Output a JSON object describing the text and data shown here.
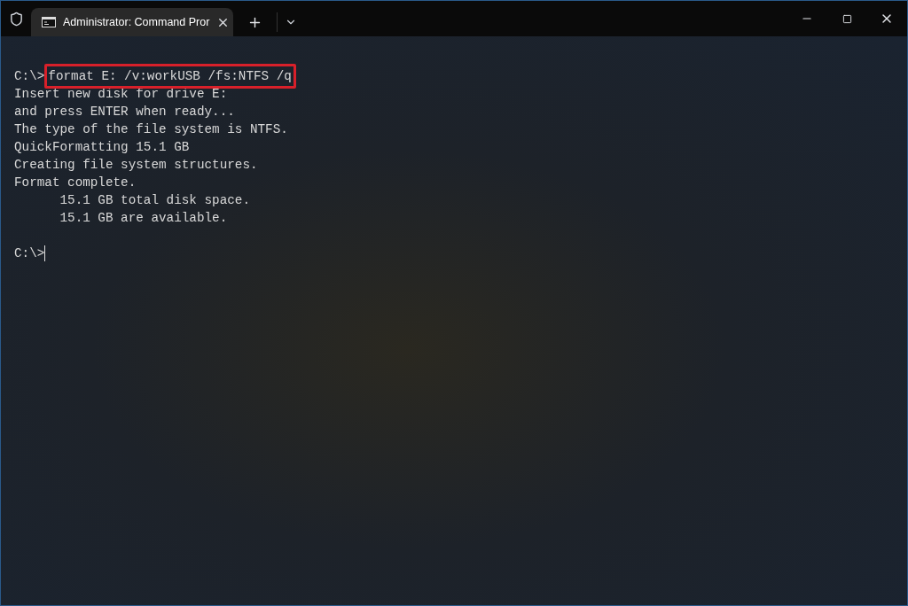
{
  "tab": {
    "title": "Administrator: Command Pror",
    "selected": true
  },
  "lines": [
    {
      "kind": "prompt",
      "prompt": "C:\\>",
      "command": "format E: /v:workUSB /fs:NTFS /q",
      "highlighted": true
    },
    {
      "kind": "output",
      "text": "Insert new disk for drive E:"
    },
    {
      "kind": "output",
      "text": "and press ENTER when ready..."
    },
    {
      "kind": "output",
      "text": "The type of the file system is NTFS."
    },
    {
      "kind": "output",
      "text": "QuickFormatting 15.1 GB"
    },
    {
      "kind": "output",
      "text": "Creating file system structures."
    },
    {
      "kind": "output",
      "text": "Format complete."
    },
    {
      "kind": "output",
      "text": "      15.1 GB total disk space."
    },
    {
      "kind": "output",
      "text": "      15.1 GB are available."
    },
    {
      "kind": "blank"
    },
    {
      "kind": "prompt",
      "prompt": "C:\\>",
      "cursor": true
    }
  ]
}
